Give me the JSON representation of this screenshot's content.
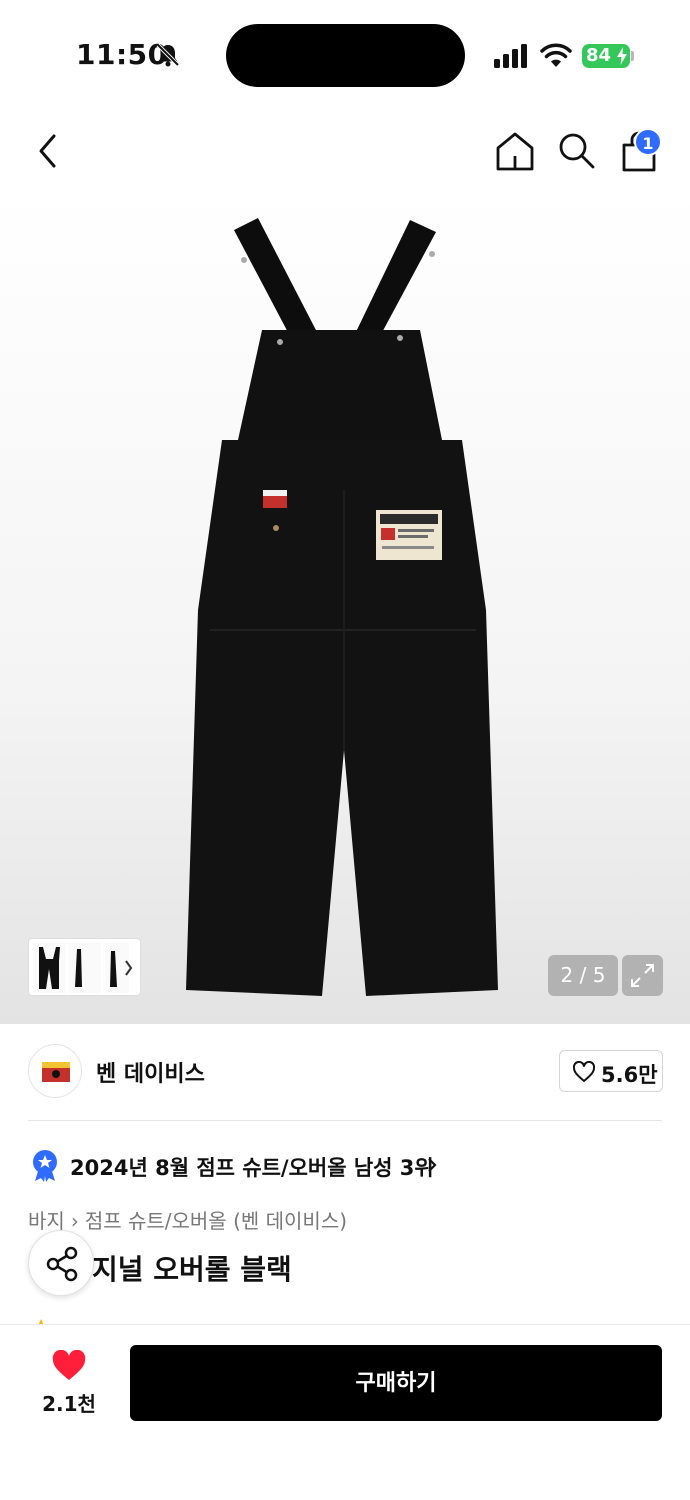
{
  "status_bar": {
    "time": "11:50",
    "battery": "84"
  },
  "header": {
    "cart_count": "1"
  },
  "gallery": {
    "counter": "2 / 5",
    "current_index": 2,
    "total_images": 5
  },
  "brand": {
    "name": "벤 데이비스",
    "likes": "5.6만"
  },
  "ranking": {
    "text": "2024년 8월 점프 슈트/오버올 남성 3위"
  },
  "breadcrumb": [
    "바지",
    "점프 슈트/오버올 (벤 데이비스)"
  ],
  "product": {
    "title": "지널 오버롤 블랙"
  },
  "bottom_bar": {
    "likes": "2.1천",
    "buy_label": "구매하기"
  },
  "colors": {
    "accent_blue": "#2f6bff",
    "battery_green": "#34c759",
    "heart_red": "#ff1f3a"
  },
  "icons": [
    "bell-off-icon",
    "signal-icon",
    "wifi-icon",
    "back-icon",
    "home-icon",
    "search-icon",
    "shopping-bag-icon",
    "expand-icon",
    "heart-icon",
    "medal-icon",
    "chevron-right-icon",
    "share-icon",
    "star-icon"
  ]
}
